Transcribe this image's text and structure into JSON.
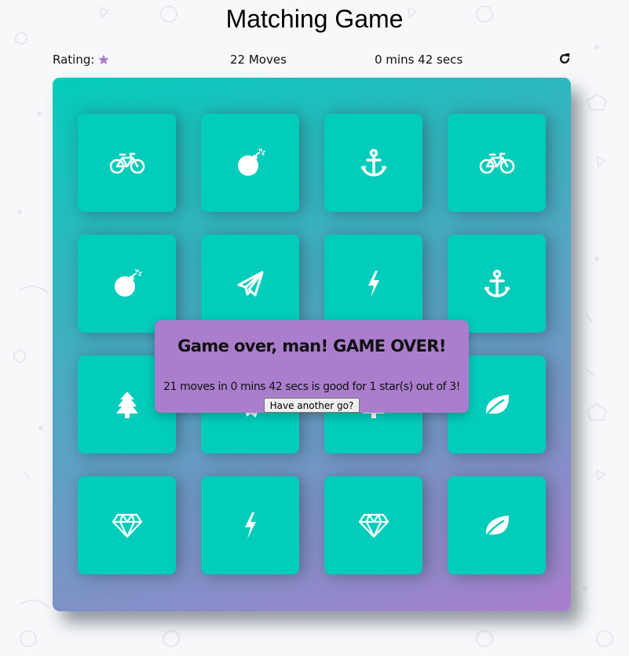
{
  "title": "Matching Game",
  "score_panel": {
    "rating_label": "Rating:",
    "stars_shown": 1,
    "star_color": "#aa7ecd",
    "moves_text": "22 Moves",
    "timer_text": "0 mins 42 secs",
    "restart_icon": "repeat-icon"
  },
  "deck": {
    "gradient_colors": [
      "#02ccba",
      "#aa7ecd"
    ],
    "card_color": "#02ccba",
    "cards": [
      {
        "icon": "bicycle-icon",
        "state": "matched"
      },
      {
        "icon": "bomb-icon",
        "state": "matched"
      },
      {
        "icon": "anchor-icon",
        "state": "matched"
      },
      {
        "icon": "bicycle-icon",
        "state": "matched"
      },
      {
        "icon": "bomb-icon",
        "state": "matched"
      },
      {
        "icon": "paper-plane-icon",
        "state": "matched"
      },
      {
        "icon": "bolt-icon",
        "state": "matched"
      },
      {
        "icon": "anchor-icon",
        "state": "matched"
      },
      {
        "icon": "tree-icon",
        "state": "matched"
      },
      {
        "icon": "paper-plane-icon",
        "state": "matched"
      },
      {
        "icon": "tree-icon",
        "state": "matched"
      },
      {
        "icon": "leaf-icon",
        "state": "matched"
      },
      {
        "icon": "diamond-icon",
        "state": "matched"
      },
      {
        "icon": "bolt-icon",
        "state": "matched"
      },
      {
        "icon": "diamond-icon",
        "state": "matched"
      },
      {
        "icon": "leaf-icon",
        "state": "matched"
      }
    ]
  },
  "modal": {
    "title": "Game over, man! GAME OVER!",
    "message": "21 moves in 0 mins 42 secs is good for 1 star(s) out of 3!",
    "button_label": "Have another go?",
    "background_color": "#aa7ecd"
  }
}
